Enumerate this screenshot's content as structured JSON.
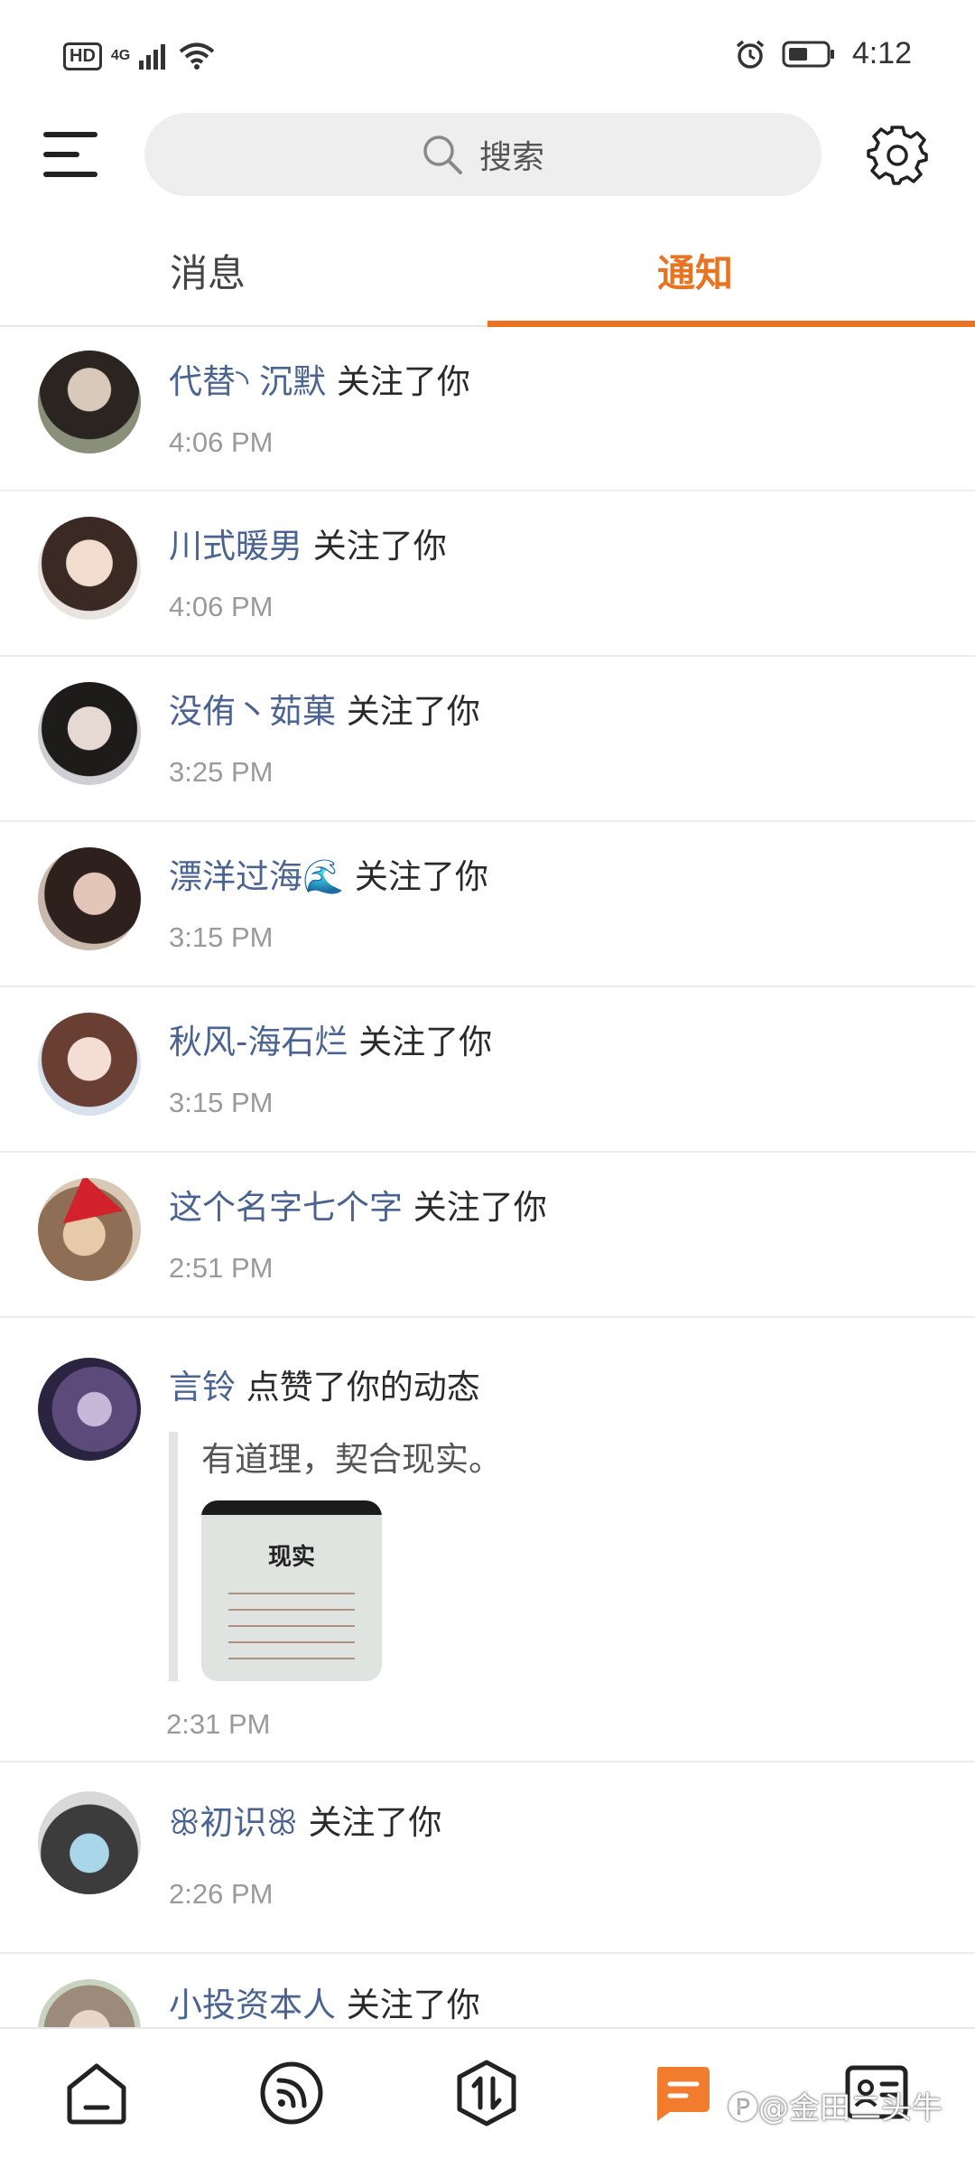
{
  "status_bar": {
    "network_hd": "HD",
    "network_gen": "4G",
    "time": "4:12"
  },
  "top_bar": {
    "search_placeholder": "搜索"
  },
  "tabs": [
    {
      "label": "消息",
      "active": false
    },
    {
      "label": "通知",
      "active": true
    }
  ],
  "notifications": [
    {
      "user": "代替◝ 沉默",
      "action": "关注了你",
      "time": "4:06 PM"
    },
    {
      "user": "川式暖男",
      "action": "关注了你",
      "time": "4:06 PM"
    },
    {
      "user": "没侑丶茹菓",
      "action": "关注了你",
      "time": "3:25 PM"
    },
    {
      "user": "漂洋过海🌊",
      "action": "关注了你",
      "time": "3:15 PM"
    },
    {
      "user": "秋风-海石烂",
      "action": "关注了你",
      "time": "3:15 PM"
    },
    {
      "user": "这个名字七个字",
      "action": "关注了你",
      "time": "2:51 PM"
    },
    {
      "user": "言铃",
      "action": "点赞了你的动态",
      "time": "2:31 PM",
      "quote_text": "有道理，契合现实。",
      "quote_image_title": "现实"
    },
    {
      "user": "ꕥ初识ꕥ",
      "action": "关注了你",
      "time": "2:26 PM"
    },
    {
      "user": "小投资本人",
      "action": "关注了你",
      "time": ""
    }
  ],
  "bottom_nav": {
    "items": [
      "home-icon",
      "feed-icon",
      "trade-icon",
      "message-icon",
      "profile-card-icon"
    ],
    "active": "message-icon",
    "accent_color": "#f27c2e"
  },
  "watermark": "🅟@金田二头牛",
  "colors": {
    "accent": "#e87322",
    "username": "#4a6390"
  }
}
